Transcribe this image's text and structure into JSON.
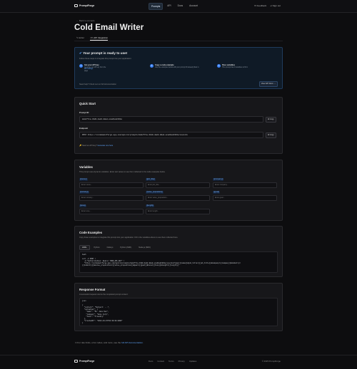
{
  "app": {
    "name": "PromptForge"
  },
  "nav": {
    "items": [
      "Prompts",
      "API",
      "Docs",
      "Account"
    ],
    "active": "Prompts"
  },
  "topright": {
    "feedback": "Feedback",
    "signout": "Sign out"
  },
  "breadcrumb": "← Back to prompts",
  "page_title": "Cold Email Writer",
  "tabs": {
    "editor": "Editor",
    "api": "API Integration"
  },
  "ready": {
    "title": "Your prompt is ready to use!",
    "subtitle": "Follow these steps to integrate this prompt into your application:",
    "steps": [
      {
        "num": "1",
        "title": "Get your API key",
        "desc_pre": "Generate an API key from the ",
        "link": "API settings",
        "desc_post": " page"
      },
      {
        "num": "2",
        "title": "Copy a code example",
        "desc": "Use the examples below with your prompt ID already filled in"
      },
      {
        "num": "3",
        "title": "Pass variables",
        "desc": "This prompt has 9 variables to fill in"
      }
    ],
    "help": "Need help? Check out our full documentation",
    "docs_button": "View API Docs →"
  },
  "quickstart": {
    "title": "Quick Start",
    "prompt_id_label": "Prompt ID",
    "prompt_id": "8e8cf7ca-3120-4a22-88ed-eca2bedc934e",
    "endpoint_label": "Endpoint",
    "endpoint": "POST https://coldemailforge-app.com/api/v1/prompts/8e8cf7ca-3120-4a22-88ed-eca2bedc934e/execute",
    "copy": "Copy",
    "need_key_pre": "🔑 Need an API key? ",
    "need_key_link": "Generate one here"
  },
  "variables": {
    "title": "Variables",
    "subtitle": "This prompt uses dynamic variables. Enter test values to see them reflected in the code examples below.",
    "items": [
      {
        "name": "{{name}}",
        "placeholder": "Enter name..."
      },
      {
        "name": "{{job_title}}",
        "placeholder": "Enter job_title..."
      },
      {
        "name": "{{company}}",
        "placeholder": "Enter company..."
      },
      {
        "name": "{{industry}}",
        "placeholder": "Enter industry..."
      },
      {
        "name": "{{value_proposition}}",
        "placeholder": "Enter value_proposition..."
      },
      {
        "name": "{{goal}}",
        "placeholder": "Enter goal..."
      },
      {
        "name": "{{tone}}",
        "placeholder": "Enter tone..."
      },
      {
        "name": "{{length}}",
        "placeholder": "Enter length..."
      }
    ]
  },
  "code_examples": {
    "title": "Code Examples",
    "subtitle": "Copy these examples to integrate this prompt into your application. Fill in the variables above to see them reflected here.",
    "langs": [
      "cURL",
      "Python",
      "Node.js",
      "Python (SDK)",
      "Node.js (SDK)"
    ],
    "active": "cURL",
    "code": "bash\n\ncurl -X POST \\\n  -H \"Authorization: Bearer YOUR_API_KEY\" \\\n  \"https://coldemailforge-app.com/api/v1/prompts/8e8cf7ca-3120-4a22-88ed-eca2bedc934e/execute?name={{name}}&job_title={{job_title}}&company={{company}}&industry=\n{{industry}}&value_proposition={{value_proposition}}&goal={{goal}}&tone={{tone}}&length={{length}}\""
  },
  "response": {
    "title": "Response Format",
    "subtitle": "A successful request returns the completed prompt content:",
    "code": "json\n\n{\n  \"content\": \"Subject: ...\",\n  \"variables\": {\n    \"name\": \"Ms. Jane Doe\",\n    \"company\": \"Acme Corp\",\n    \"tone\": \"friendly\"\n  },\n  \"createdAt\": \"2024-01-15T10:30:00.000Z\"\n}"
  },
  "api_note": {
    "pre": "For rate limits, error codes, and more, see the ",
    "link": "full API documentation",
    "post": "."
  },
  "footer": {
    "links": [
      "Docs",
      "Contact",
      "Terms",
      "Privacy",
      "Updates"
    ],
    "copyright": "© 2025 PromptForge"
  },
  "colors": {
    "accent": "#3b82f6",
    "background": "#0d0d0f",
    "card": "#17171a"
  }
}
